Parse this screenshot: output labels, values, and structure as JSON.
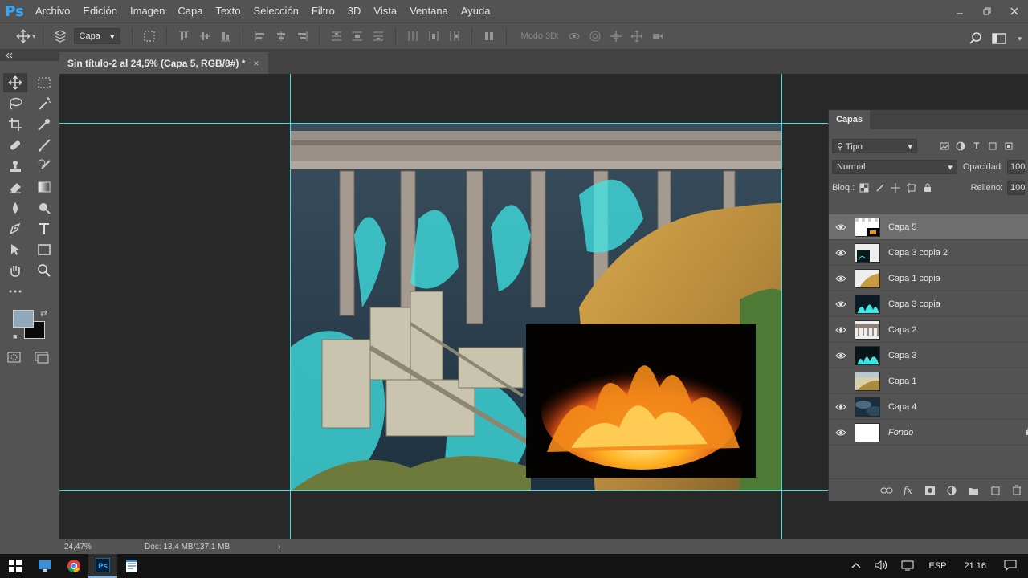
{
  "app": {
    "logo": "Ps",
    "menu": [
      "Archivo",
      "Edición",
      "Imagen",
      "Capa",
      "Texto",
      "Selección",
      "Filtro",
      "3D",
      "Vista",
      "Ventana",
      "Ayuda"
    ],
    "window_controls": [
      "minimize-icon",
      "restore-icon",
      "close-icon"
    ]
  },
  "options_bar": {
    "auto_select_value": "Capa",
    "mode_3d_label": "Modo 3D:"
  },
  "document": {
    "tab_title": "Sin título-2 al 24,5% (Capa 5, RGB/8#) *",
    "close_glyph": "×"
  },
  "status": {
    "zoom": "24,47%",
    "doc_info": "Doc: 13,4 MB/137,1 MB",
    "arrow": "›"
  },
  "colors": {
    "foreground": "#8fa9ba",
    "background": "#0a0a0a",
    "guide": "#40e0e8"
  },
  "layers_panel": {
    "tab": "Capas",
    "filter_kind": "Tipo",
    "blend_mode": "Normal",
    "opacity_label": "Opacidad:",
    "opacity_value": "100",
    "lock_label": "Bloq.:",
    "fill_label": "Relleno:",
    "fill_value": "100",
    "layers": [
      {
        "name": "Capa 5",
        "visible": true,
        "selected": true
      },
      {
        "name": "Capa 3 copia 2",
        "visible": true,
        "selected": false
      },
      {
        "name": "Capa 1 copia",
        "visible": true,
        "selected": false
      },
      {
        "name": "Capa 3 copia",
        "visible": true,
        "selected": false
      },
      {
        "name": "Capa 2",
        "visible": true,
        "selected": false
      },
      {
        "name": "Capa 3",
        "visible": true,
        "selected": false
      },
      {
        "name": "Capa 1",
        "visible": false,
        "selected": false
      },
      {
        "name": "Capa 4",
        "visible": true,
        "selected": false
      },
      {
        "name": "Fondo",
        "visible": true,
        "selected": false,
        "italic": true
      }
    ]
  },
  "taskbar": {
    "language": "ESP",
    "time": "21:16"
  }
}
